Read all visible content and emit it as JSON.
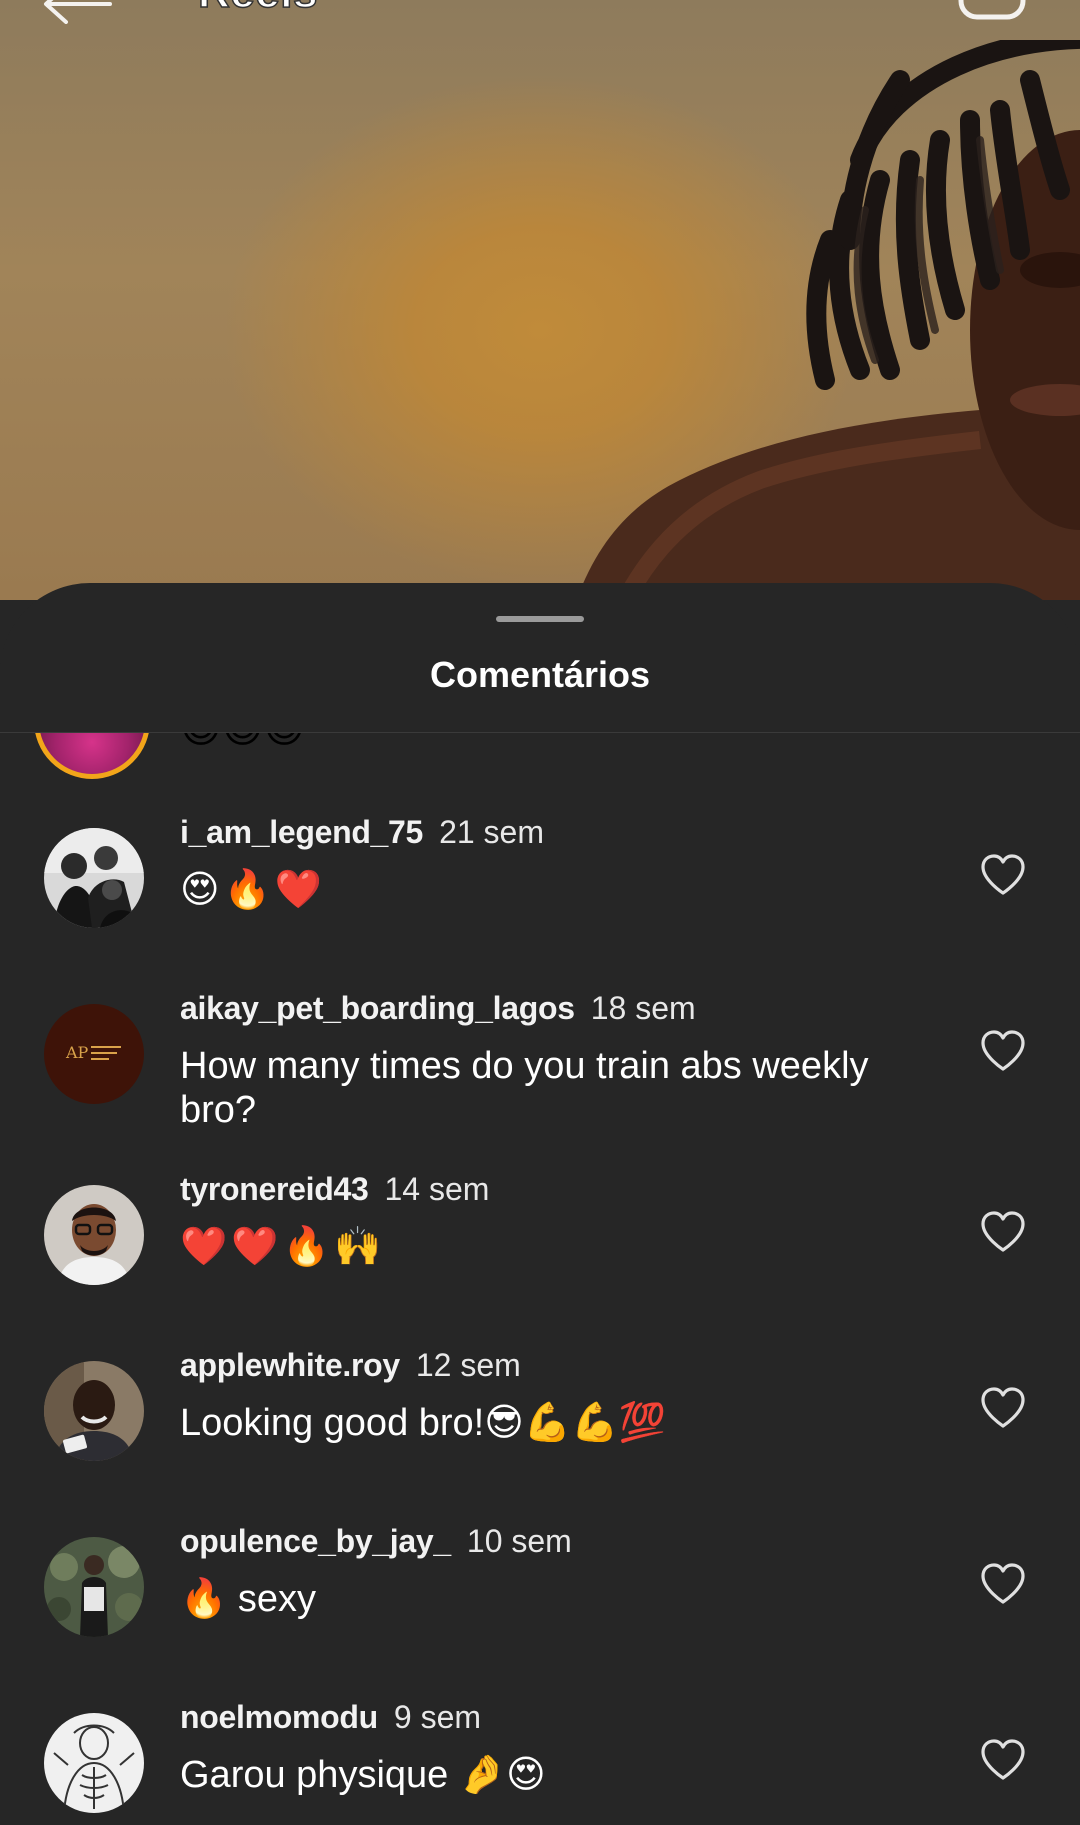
{
  "header": {
    "title": "Reels"
  },
  "sheet": {
    "title": "Comentários"
  },
  "partial_comment": {
    "text": "😊😊😊"
  },
  "comments": [
    {
      "username": "i_am_legend_75",
      "time": "21 sem",
      "text": "😍🔥❤️",
      "avatar": "black-white-photo"
    },
    {
      "username": "aikay_pet_boarding_lagos",
      "time": "18 sem",
      "text": "How many times do you train abs weekly bro?",
      "avatar": "pet-boarding-logo"
    },
    {
      "username": "tyronereid43",
      "time": "14 sem",
      "text": "❤️❤️🔥🙌",
      "avatar": "man-with-glasses"
    },
    {
      "username": "applewhite.roy",
      "time": "12 sem",
      "text": "Looking good bro!😎💪💪💯",
      "avatar": "man-smiling"
    },
    {
      "username": "opulence_by_jay_",
      "time": "10 sem",
      "text": "🔥 sexy",
      "avatar": "man-in-garden"
    },
    {
      "username": "noelmomodu",
      "time": "9 sem",
      "text": "Garou physique 🤌😍",
      "avatar": "manga-drawing"
    }
  ],
  "colors": {
    "sheet_bg": "#262626",
    "text": "#ffffff",
    "partial_ring": "#f2a51a"
  },
  "icons": {
    "back": "arrow-left-icon",
    "camera": "camera-icon",
    "like": "heart-outline-icon"
  }
}
